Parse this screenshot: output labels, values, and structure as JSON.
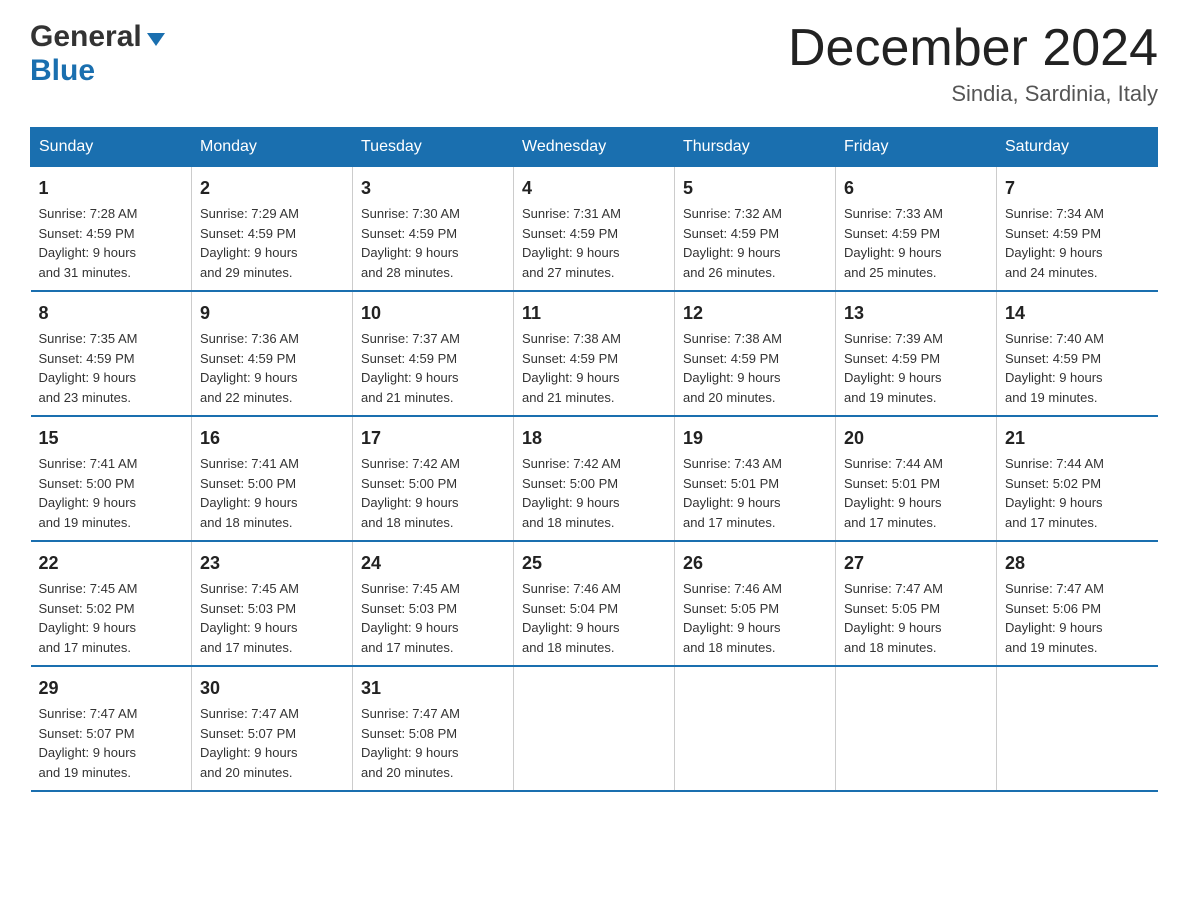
{
  "header": {
    "logo_general": "General",
    "logo_blue": "Blue",
    "month_title": "December 2024",
    "location": "Sindia, Sardinia, Italy"
  },
  "days_of_week": [
    "Sunday",
    "Monday",
    "Tuesday",
    "Wednesday",
    "Thursday",
    "Friday",
    "Saturday"
  ],
  "weeks": [
    [
      {
        "day": "1",
        "sunrise": "7:28 AM",
        "sunset": "4:59 PM",
        "daylight": "9 hours and 31 minutes."
      },
      {
        "day": "2",
        "sunrise": "7:29 AM",
        "sunset": "4:59 PM",
        "daylight": "9 hours and 29 minutes."
      },
      {
        "day": "3",
        "sunrise": "7:30 AM",
        "sunset": "4:59 PM",
        "daylight": "9 hours and 28 minutes."
      },
      {
        "day": "4",
        "sunrise": "7:31 AM",
        "sunset": "4:59 PM",
        "daylight": "9 hours and 27 minutes."
      },
      {
        "day": "5",
        "sunrise": "7:32 AM",
        "sunset": "4:59 PM",
        "daylight": "9 hours and 26 minutes."
      },
      {
        "day": "6",
        "sunrise": "7:33 AM",
        "sunset": "4:59 PM",
        "daylight": "9 hours and 25 minutes."
      },
      {
        "day": "7",
        "sunrise": "7:34 AM",
        "sunset": "4:59 PM",
        "daylight": "9 hours and 24 minutes."
      }
    ],
    [
      {
        "day": "8",
        "sunrise": "7:35 AM",
        "sunset": "4:59 PM",
        "daylight": "9 hours and 23 minutes."
      },
      {
        "day": "9",
        "sunrise": "7:36 AM",
        "sunset": "4:59 PM",
        "daylight": "9 hours and 22 minutes."
      },
      {
        "day": "10",
        "sunrise": "7:37 AM",
        "sunset": "4:59 PM",
        "daylight": "9 hours and 21 minutes."
      },
      {
        "day": "11",
        "sunrise": "7:38 AM",
        "sunset": "4:59 PM",
        "daylight": "9 hours and 21 minutes."
      },
      {
        "day": "12",
        "sunrise": "7:38 AM",
        "sunset": "4:59 PM",
        "daylight": "9 hours and 20 minutes."
      },
      {
        "day": "13",
        "sunrise": "7:39 AM",
        "sunset": "4:59 PM",
        "daylight": "9 hours and 19 minutes."
      },
      {
        "day": "14",
        "sunrise": "7:40 AM",
        "sunset": "4:59 PM",
        "daylight": "9 hours and 19 minutes."
      }
    ],
    [
      {
        "day": "15",
        "sunrise": "7:41 AM",
        "sunset": "5:00 PM",
        "daylight": "9 hours and 19 minutes."
      },
      {
        "day": "16",
        "sunrise": "7:41 AM",
        "sunset": "5:00 PM",
        "daylight": "9 hours and 18 minutes."
      },
      {
        "day": "17",
        "sunrise": "7:42 AM",
        "sunset": "5:00 PM",
        "daylight": "9 hours and 18 minutes."
      },
      {
        "day": "18",
        "sunrise": "7:42 AM",
        "sunset": "5:00 PM",
        "daylight": "9 hours and 18 minutes."
      },
      {
        "day": "19",
        "sunrise": "7:43 AM",
        "sunset": "5:01 PM",
        "daylight": "9 hours and 17 minutes."
      },
      {
        "day": "20",
        "sunrise": "7:44 AM",
        "sunset": "5:01 PM",
        "daylight": "9 hours and 17 minutes."
      },
      {
        "day": "21",
        "sunrise": "7:44 AM",
        "sunset": "5:02 PM",
        "daylight": "9 hours and 17 minutes."
      }
    ],
    [
      {
        "day": "22",
        "sunrise": "7:45 AM",
        "sunset": "5:02 PM",
        "daylight": "9 hours and 17 minutes."
      },
      {
        "day": "23",
        "sunrise": "7:45 AM",
        "sunset": "5:03 PM",
        "daylight": "9 hours and 17 minutes."
      },
      {
        "day": "24",
        "sunrise": "7:45 AM",
        "sunset": "5:03 PM",
        "daylight": "9 hours and 17 minutes."
      },
      {
        "day": "25",
        "sunrise": "7:46 AM",
        "sunset": "5:04 PM",
        "daylight": "9 hours and 18 minutes."
      },
      {
        "day": "26",
        "sunrise": "7:46 AM",
        "sunset": "5:05 PM",
        "daylight": "9 hours and 18 minutes."
      },
      {
        "day": "27",
        "sunrise": "7:47 AM",
        "sunset": "5:05 PM",
        "daylight": "9 hours and 18 minutes."
      },
      {
        "day": "28",
        "sunrise": "7:47 AM",
        "sunset": "5:06 PM",
        "daylight": "9 hours and 19 minutes."
      }
    ],
    [
      {
        "day": "29",
        "sunrise": "7:47 AM",
        "sunset": "5:07 PM",
        "daylight": "9 hours and 19 minutes."
      },
      {
        "day": "30",
        "sunrise": "7:47 AM",
        "sunset": "5:07 PM",
        "daylight": "9 hours and 20 minutes."
      },
      {
        "day": "31",
        "sunrise": "7:47 AM",
        "sunset": "5:08 PM",
        "daylight": "9 hours and 20 minutes."
      },
      null,
      null,
      null,
      null
    ]
  ]
}
